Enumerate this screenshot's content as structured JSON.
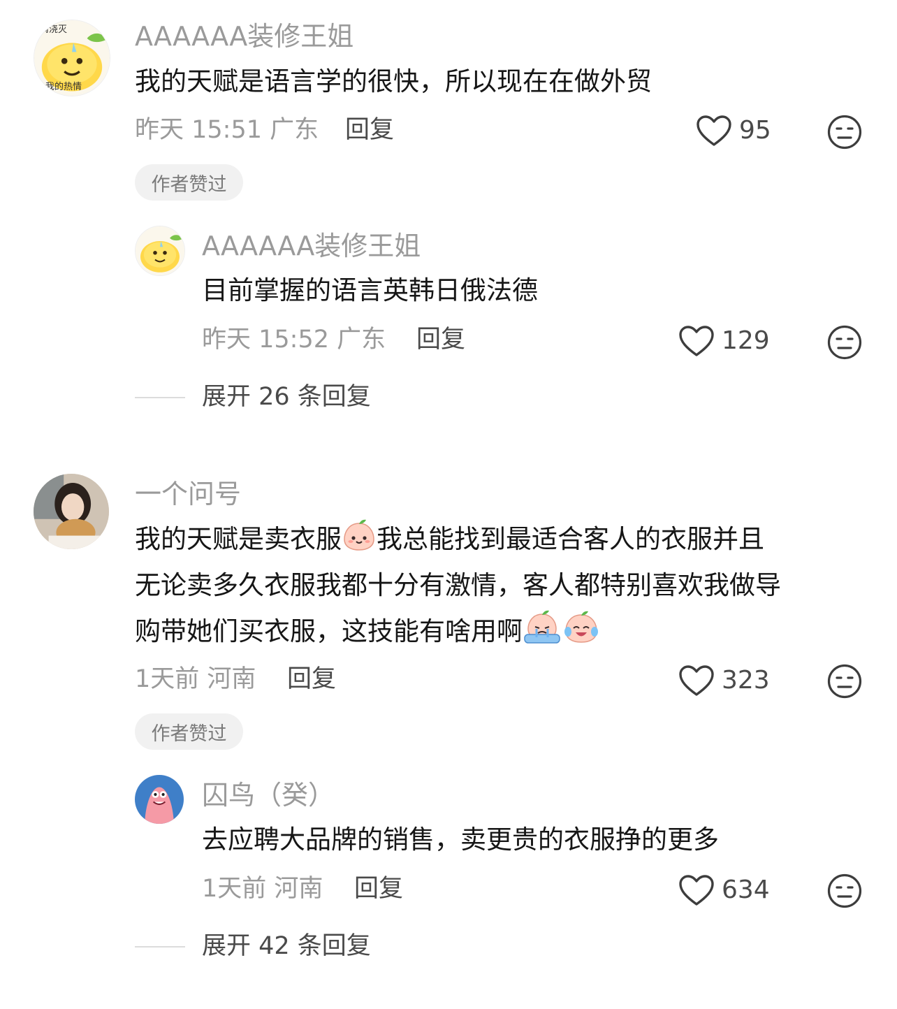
{
  "comments": [
    {
      "username": "AAAAAA装修王姐",
      "content": "我的天赋是语言学的很快，所以现在在做外贸",
      "time": "昨天 15:51 广东",
      "reply_label": "回复",
      "likes": "95",
      "badge": "作者赞过",
      "replies": [
        {
          "username": "AAAAAA装修王姐",
          "content": "目前掌握的语言英韩日俄法德",
          "time": "昨天 15:52 广东",
          "reply_label": "回复",
          "likes": "129"
        }
      ],
      "expand_label": "展开 26 条回复"
    },
    {
      "username": "一个问号",
      "content_lines": [
        "我的天赋是卖衣服",
        "我总能找到最适合客人的衣服并且",
        "无论卖多久衣服我都十分有激情，客人都特别喜欢我做导",
        "购带她们买衣服，这技能有啥用啊"
      ],
      "time": "1天前 河南",
      "reply_label": "回复",
      "likes": "323",
      "badge": "作者赞过",
      "replies": [
        {
          "username": "囚鸟（癸）",
          "content": "去应聘大品牌的销售，卖更贵的衣服挣的更多",
          "time": "1天前 河南",
          "reply_label": "回复",
          "likes": "634"
        }
      ],
      "expand_label": "展开 42 条回复"
    }
  ],
  "avatar_text": {
    "top": "情浇灭",
    "bottom": "我的热情"
  },
  "icons": {
    "like": "heart-outline-icon",
    "dislike": "meh-face-icon"
  },
  "colors": {
    "text": "#161616",
    "muted": "#9a9a9a",
    "action": "#4a4a4a",
    "badge_bg": "#f1f1f1"
  }
}
